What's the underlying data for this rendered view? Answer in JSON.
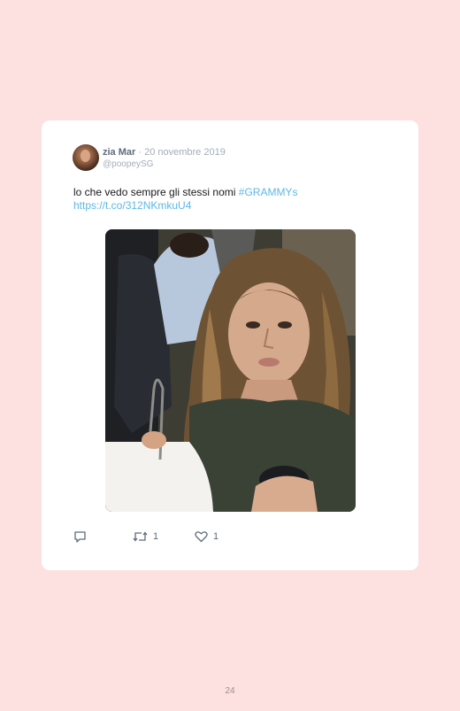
{
  "tweet": {
    "author_name": "zia Mar",
    "date": "· 20 novembre 2019",
    "handle": "@poopeySG",
    "text": "lo che vedo sempre gli stessi nomi",
    "hashtag": "#GRAMMYs",
    "link": "https://t.co/312NKmkuU4",
    "media_description": "GIF of a woman with long wavy hair looking sideways",
    "actions": {
      "reply_icon": "reply-icon",
      "retweet_icon": "retweet-icon",
      "retweet_count": "1",
      "like_icon": "heart-icon",
      "like_count": "1"
    }
  },
  "page": {
    "number": "24"
  },
  "colors": {
    "background": "#fde0e0",
    "card": "#ffffff",
    "link": "#5cb8e6",
    "meta": "#a3adb8"
  }
}
